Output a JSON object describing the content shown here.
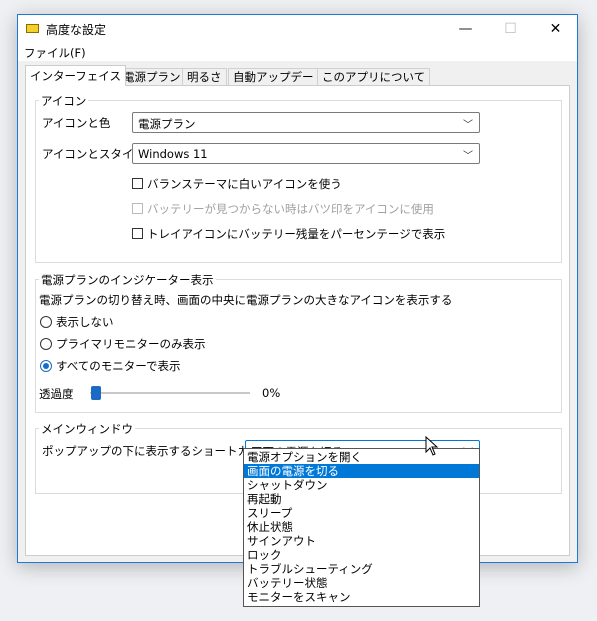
{
  "window": {
    "title": "高度な設定",
    "accent": "#0078d7"
  },
  "titlebar": {
    "minimize": "—",
    "maximize": "☐",
    "close": "✕"
  },
  "menu": {
    "file": "ファイル(F)"
  },
  "tabs": [
    {
      "label": "インターフェイス",
      "active": true
    },
    {
      "label": "電源プラン",
      "active": false
    },
    {
      "label": "明るさ",
      "active": false
    },
    {
      "label": "自動アップデート",
      "active": false
    },
    {
      "label": "このアプリについて",
      "active": false
    }
  ],
  "icon_group": {
    "title": "アイコン",
    "icon_color_label": "アイコンと色",
    "icon_color_value": "電源プラン",
    "icon_style_label": "アイコンとスタイル",
    "icon_style_value": "Windows 11",
    "checkbox_white_icon": "バランステーマに白いアイコンを使う",
    "checkbox_battery_x": "バッテリーが見つからない時はバツ印をアイコンに使用",
    "checkbox_battery_percent": "トレイアイコンにバッテリー残量をパーセンテージで表示"
  },
  "indicator_group": {
    "title": "電源プランのインジケーター表示",
    "description": "電源プランの切り替え時、画面の中央に電源プランの大きなアイコンを表示する",
    "radio_none": "表示しない",
    "radio_primary": "プライマリモニターのみ表示",
    "radio_all": "すべてのモニターで表示",
    "selected": "radio_all",
    "opacity_label": "透過度",
    "opacity_value": "0%",
    "opacity_level": 0
  },
  "main_window_group": {
    "title": "メインウィンドウ",
    "shortcut_label": "ポップアップの下に表示するショートカット",
    "shortcut_value": "画面の電源を切る"
  },
  "dropdown": {
    "options": [
      "電源オプションを開く",
      "画面の電源を切る",
      "シャットダウン",
      "再起動",
      "スリープ",
      "休止状態",
      "サインアウト",
      "ロック",
      "トラブルシューティング",
      "バッテリー状態",
      "モニターをスキャン"
    ],
    "selected_index": 1
  }
}
